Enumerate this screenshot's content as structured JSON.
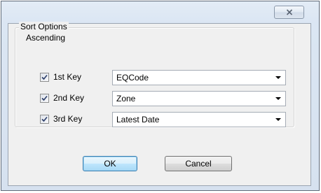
{
  "dialog": {
    "close_icon": "close-icon"
  },
  "sort_options": {
    "group_title": "Sort Options",
    "order_label": "Ascending",
    "keys": [
      {
        "label": "1st Key",
        "checked": true,
        "value": "EQCode"
      },
      {
        "label": "2nd Key",
        "checked": true,
        "value": "Zone"
      },
      {
        "label": "3rd Key",
        "checked": true,
        "value": "Latest Date"
      }
    ]
  },
  "buttons": {
    "ok_label": "OK",
    "cancel_label": "Cancel"
  }
}
